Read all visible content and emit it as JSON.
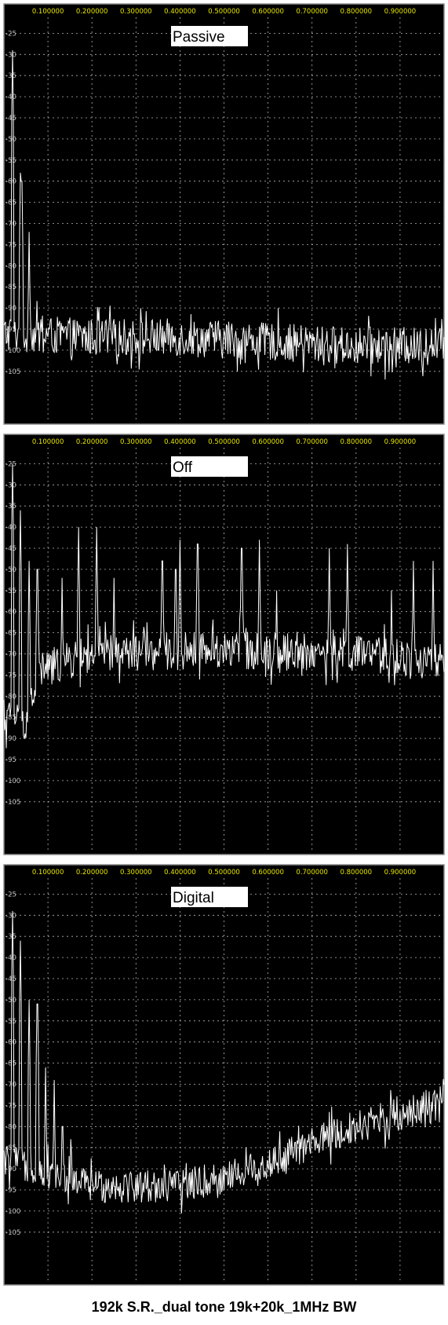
{
  "caption": "192k S.R._dual tone 19k+20k_1MHz BW",
  "colors": {
    "background": "#000000",
    "border": "#8c8c8c",
    "grid": "#b4b4b4",
    "x_tick_text": "#e6e600",
    "y_tick_text": "#bfbfbf",
    "trace": "#ffffff",
    "label_box": "#ffffff",
    "label_text": "#000000"
  },
  "chart_data": [
    {
      "type": "line",
      "panel_label": "Passive",
      "xlim": [
        0,
        1.0
      ],
      "ylim": [
        -110,
        -20
      ],
      "x_ticks": [
        "0.100000",
        "0.200000",
        "0.300000",
        "0.400000",
        "0.500000",
        "0.600000",
        "0.700000",
        "0.800000",
        "0.900000"
      ],
      "y_ticks": [
        "-25",
        "-30",
        "-35",
        "-40",
        "-45",
        "-50",
        "-55",
        "-60",
        "-65",
        "-70",
        "-75",
        "-80",
        "-85",
        "-90",
        "-95",
        "-100",
        "-105"
      ],
      "grid": true,
      "spurs": [
        [
          0.019,
          -29
        ],
        [
          0.038,
          -58
        ],
        [
          0.057,
          -72
        ],
        [
          0.02,
          -31
        ],
        [
          0.04,
          -60
        ]
      ],
      "floor": [
        [
          0,
          -96
        ],
        [
          0.2,
          -97
        ],
        [
          0.4,
          -97
        ],
        [
          0.6,
          -98
        ],
        [
          0.8,
          -99
        ],
        [
          1.0,
          -99
        ]
      ],
      "noise_amplitude": 4.5
    },
    {
      "type": "line",
      "panel_label": "Off",
      "xlim": [
        0,
        1.0
      ],
      "ylim": [
        -110,
        -20
      ],
      "x_ticks": [
        "0.100000",
        "0.200000",
        "0.300000",
        "0.400000",
        "0.500000",
        "0.600000",
        "0.700000",
        "0.800000",
        "0.900000"
      ],
      "y_ticks": [
        "-25",
        "-30",
        "-35",
        "-40",
        "-45",
        "-50",
        "-55",
        "-60",
        "-65",
        "-70",
        "-75",
        "-80",
        "-85",
        "-90",
        "-95",
        "-100",
        "-105"
      ],
      "grid": true,
      "spurs": [
        [
          0.019,
          -25
        ],
        [
          0.038,
          -36
        ],
        [
          0.057,
          -48
        ],
        [
          0.076,
          -50
        ],
        [
          0.17,
          -40
        ],
        [
          0.211,
          -40
        ],
        [
          0.132,
          -52
        ],
        [
          0.25,
          -52
        ],
        [
          0.36,
          -48
        ],
        [
          0.39,
          -50
        ],
        [
          0.4,
          -43
        ],
        [
          0.44,
          -44
        ],
        [
          0.54,
          -45
        ],
        [
          0.58,
          -43
        ],
        [
          0.62,
          -55
        ],
        [
          0.74,
          -45
        ],
        [
          0.78,
          -44
        ],
        [
          0.88,
          -55
        ],
        [
          0.93,
          -48
        ],
        [
          0.975,
          -48
        ]
      ],
      "floor": [
        [
          0,
          -85
        ],
        [
          0.05,
          -86
        ],
        [
          0.08,
          -74
        ],
        [
          0.2,
          -70
        ],
        [
          0.5,
          -69
        ],
        [
          0.8,
          -70
        ],
        [
          1.0,
          -72
        ]
      ],
      "noise_amplitude": 4.5
    },
    {
      "type": "line",
      "panel_label": "Digital",
      "xlim": [
        0,
        1.0
      ],
      "ylim": [
        -110,
        -20
      ],
      "x_ticks": [
        "0.100000",
        "0.200000",
        "0.300000",
        "0.400000",
        "0.500000",
        "0.600000",
        "0.700000",
        "0.800000",
        "0.900000"
      ],
      "y_ticks": [
        "-25",
        "-30",
        "-35",
        "-40",
        "-45",
        "-50",
        "-55",
        "-60",
        "-65",
        "-70",
        "-75",
        "-80",
        "-85",
        "-90",
        "-95",
        "-100",
        "-105"
      ],
      "grid": true,
      "spurs": [
        [
          0.019,
          -29
        ],
        [
          0.038,
          -36
        ],
        [
          0.057,
          -50
        ],
        [
          0.076,
          -51
        ],
        [
          0.095,
          -66
        ],
        [
          0.114,
          -69
        ],
        [
          0.133,
          -80
        ],
        [
          0.152,
          -83
        ]
      ],
      "floor": [
        [
          0,
          -88
        ],
        [
          0.1,
          -91
        ],
        [
          0.2,
          -94
        ],
        [
          0.4,
          -94
        ],
        [
          0.5,
          -92
        ],
        [
          0.6,
          -89
        ],
        [
          0.7,
          -84
        ],
        [
          0.8,
          -80
        ],
        [
          0.9,
          -77
        ],
        [
          1.0,
          -74
        ]
      ],
      "noise_amplitude": 4.0
    }
  ]
}
